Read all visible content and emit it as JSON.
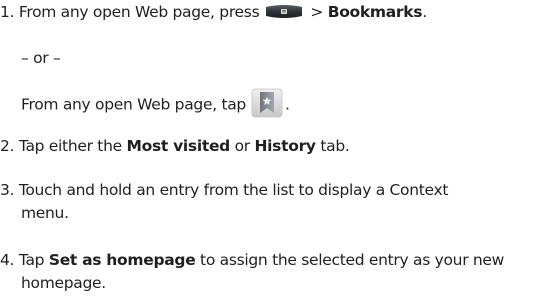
{
  "steps": [
    {
      "number": "1.",
      "pre": "From any open Web page, press",
      "between": ">",
      "bold": "Bookmarks",
      "post": ".",
      "or_text": "– or –",
      "alt_pre": "From any open Web page, tap",
      "alt_post": ".",
      "menu_key_icon": "menu-key-icon",
      "bookmark_icon": "bookmark-icon"
    },
    {
      "number": "2.",
      "pre": "Tap either the",
      "bold1": "Most visited",
      "mid": "or",
      "bold2": "History",
      "post": "tab."
    },
    {
      "number": "3.",
      "line1": "Touch and hold an entry from the list to display a Context",
      "line2": "menu."
    },
    {
      "number": "4.",
      "pre": "Tap",
      "bold": "Set as homepage",
      "post": "to assign the selected entry as your new",
      "line2": "homepage."
    }
  ],
  "colors": {
    "text": "#231f20",
    "menu_key_body": "#2f3236",
    "bookmark_tile": "#dcdcdc",
    "bookmark_ribbon": "#8a8f96"
  }
}
